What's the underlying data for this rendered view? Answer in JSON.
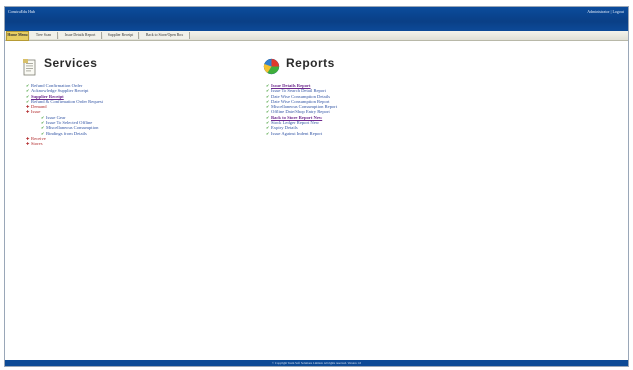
{
  "window": {
    "app_title": "ConstruEdu Hub",
    "user_info": "Administrator | Logout"
  },
  "nav": {
    "tabs": [
      {
        "label": "Home Menu",
        "active": true
      },
      {
        "label": "Tree Scan",
        "active": false
      },
      {
        "label": "Issue Details Report",
        "active": false
      },
      {
        "label": "Supplier Receipt",
        "active": false
      },
      {
        "label": "Back to Store/Open Box",
        "active": false
      }
    ]
  },
  "services": {
    "title": "Services",
    "items": [
      {
        "label": "Refund Confirmation Order",
        "state": "normal"
      },
      {
        "label": "Acknowledge Supplier Receipt",
        "state": "normal"
      },
      {
        "label": "Supplier Receipt",
        "state": "visited"
      },
      {
        "label": "Refund & Confirmation Order Request",
        "state": "normal"
      },
      {
        "label": "Demand",
        "state": "red"
      },
      {
        "label": "Issue",
        "state": "expanded"
      },
      {
        "label": "Issue Gear",
        "state": "sub"
      },
      {
        "label": "Issue To Selected Offline",
        "state": "sub"
      },
      {
        "label": "Miscellaneous Consumption",
        "state": "sub"
      },
      {
        "label": "Bindings from Details",
        "state": "sub"
      },
      {
        "label": "Receive",
        "state": "red"
      },
      {
        "label": "Stores",
        "state": "red"
      }
    ]
  },
  "reports": {
    "title": "Reports",
    "items": [
      {
        "label": "Issue Details Report",
        "state": "visited"
      },
      {
        "label": "Issue To Search Detail Report",
        "state": "normal"
      },
      {
        "label": "Date Wise Consumption Details",
        "state": "normal"
      },
      {
        "label": "Date Wise Consumption Report",
        "state": "normal"
      },
      {
        "label": "Miscellaneous Consumption Report",
        "state": "normal"
      },
      {
        "label": "Offline Date/Shop Entry Report",
        "state": "normal"
      },
      {
        "label": "Back to Store Report New",
        "state": "visited"
      },
      {
        "label": "Stock Ledger Report New",
        "state": "normal"
      },
      {
        "label": "Expiry Details",
        "state": "normal"
      },
      {
        "label": "Issue Against Indent Report",
        "state": "normal"
      }
    ]
  },
  "footer": {
    "text": "© Copyright Team Soft Solutions Limited. All rights reserved. Version 1.0"
  },
  "colors": {
    "header_blue": "#0b4c9c",
    "active_tab": "#e7cf62",
    "link_blue": "#3154a4",
    "visited_purple": "#6e2a8e",
    "bullet_green": "#3c9a2f",
    "expand_red": "#b0282a"
  }
}
